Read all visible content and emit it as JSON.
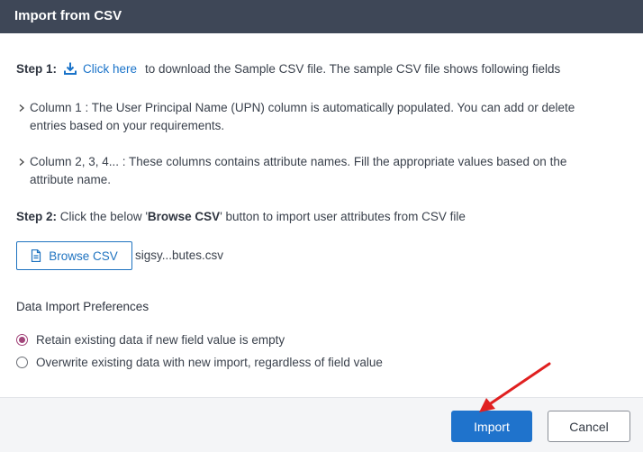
{
  "dialog": {
    "title": "Import from CSV"
  },
  "step1": {
    "label": "Step 1:",
    "link_text": "Click here",
    "link_icon": "download-icon",
    "suffix": "to download the Sample CSV file. The sample CSV file shows following fields"
  },
  "bullets": [
    {
      "text": "Column 1 : The User Principal Name (UPN) column is automatically populated. You can add or delete entries based on your requirements."
    },
    {
      "text": "Column 2, 3, 4... : These columns contains attribute names. Fill the appropriate values based on the attribute name."
    }
  ],
  "step2": {
    "label": "Step 2:",
    "prefix": "Click the below '",
    "button_ref": "Browse CSV",
    "suffix": "' button to import user attributes from CSV file"
  },
  "browse": {
    "label": "Browse CSV",
    "icon": "file-icon",
    "filename": "sigsy...butes.csv"
  },
  "preferences": {
    "title": "Data Import Preferences",
    "options": [
      {
        "label": "Retain existing data if new field value is empty",
        "checked": true
      },
      {
        "label": "Overwrite existing data with new import, regardless of field value",
        "checked": false
      }
    ]
  },
  "footer": {
    "import_label": "Import",
    "cancel_label": "Cancel"
  },
  "colors": {
    "header_bg": "#3e4757",
    "primary": "#1f73cc",
    "link": "#1a73c9",
    "radio_checked": "#a2457a",
    "annotation_arrow": "#e02020"
  }
}
